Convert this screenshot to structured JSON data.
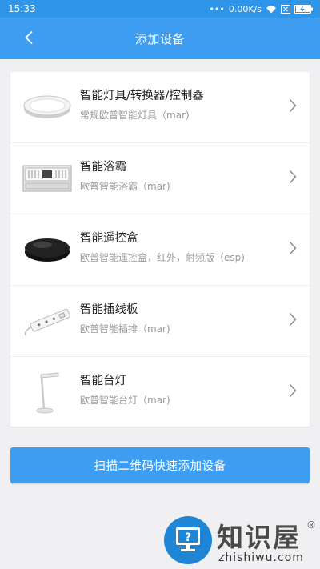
{
  "status_bar": {
    "time": "15:33",
    "network_speed": "0.00K/s",
    "icons": [
      "dots-icon",
      "wifi-icon",
      "close-box-icon",
      "battery-charging-icon"
    ]
  },
  "header": {
    "title": "添加设备",
    "back_icon": "chevron-left-icon"
  },
  "devices": [
    {
      "title": "智能灯具/转换器/控制器",
      "subtitle": "常规欧普智能灯具（mar)",
      "icon": "ceiling-light-image"
    },
    {
      "title": "智能浴霸",
      "subtitle": "欧普智能浴霸（mar)",
      "icon": "bath-heater-image"
    },
    {
      "title": "智能遥控盒",
      "subtitle": "欧普智能遥控盒，红外，射频版（esp)",
      "icon": "remote-box-image"
    },
    {
      "title": "智能插线板",
      "subtitle": "欧普智能插排（mar)",
      "icon": "power-strip-image"
    },
    {
      "title": "智能台灯",
      "subtitle": "欧普智能台灯（mar)",
      "icon": "desk-lamp-image"
    }
  ],
  "scan_button": {
    "label": "扫描二维码快速添加设备"
  },
  "watermark": {
    "brand": "知识屋",
    "url": "zhishiwu.com",
    "reg": "®"
  },
  "colors": {
    "primary": "#3d9df0",
    "status_bar": "#2f95e9",
    "background": "#f0f0f3"
  }
}
